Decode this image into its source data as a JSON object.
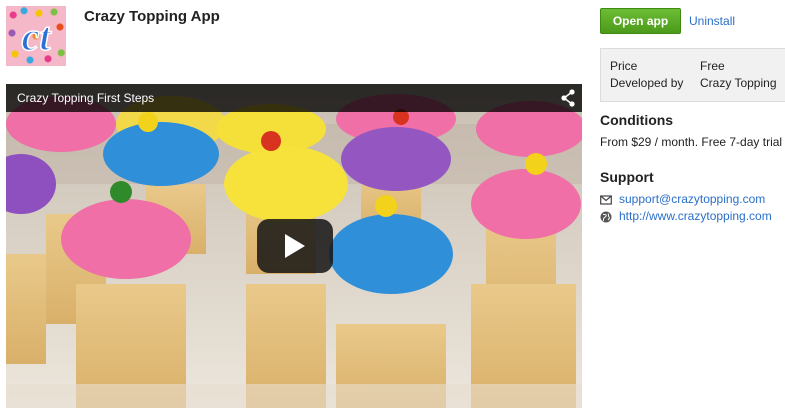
{
  "app": {
    "logo_letters": "ct",
    "title": "Crazy Topping App"
  },
  "video": {
    "title": "Crazy Topping First Steps"
  },
  "actions": {
    "open_label": "Open app",
    "uninstall_label": "Uninstall"
  },
  "info": {
    "price_label": "Price",
    "price_value": "Free",
    "developer_label": "Developed by",
    "developer_value": "Crazy Topping"
  },
  "conditions": {
    "heading": "Conditions",
    "text": "From $29 / month. Free 7-day trial"
  },
  "support": {
    "heading": "Support",
    "email": "support@crazytopping.com",
    "website": "http://www.crazytopping.com"
  },
  "colors": {
    "accent_green": "#5aa824",
    "link_blue": "#2a6fc9"
  }
}
